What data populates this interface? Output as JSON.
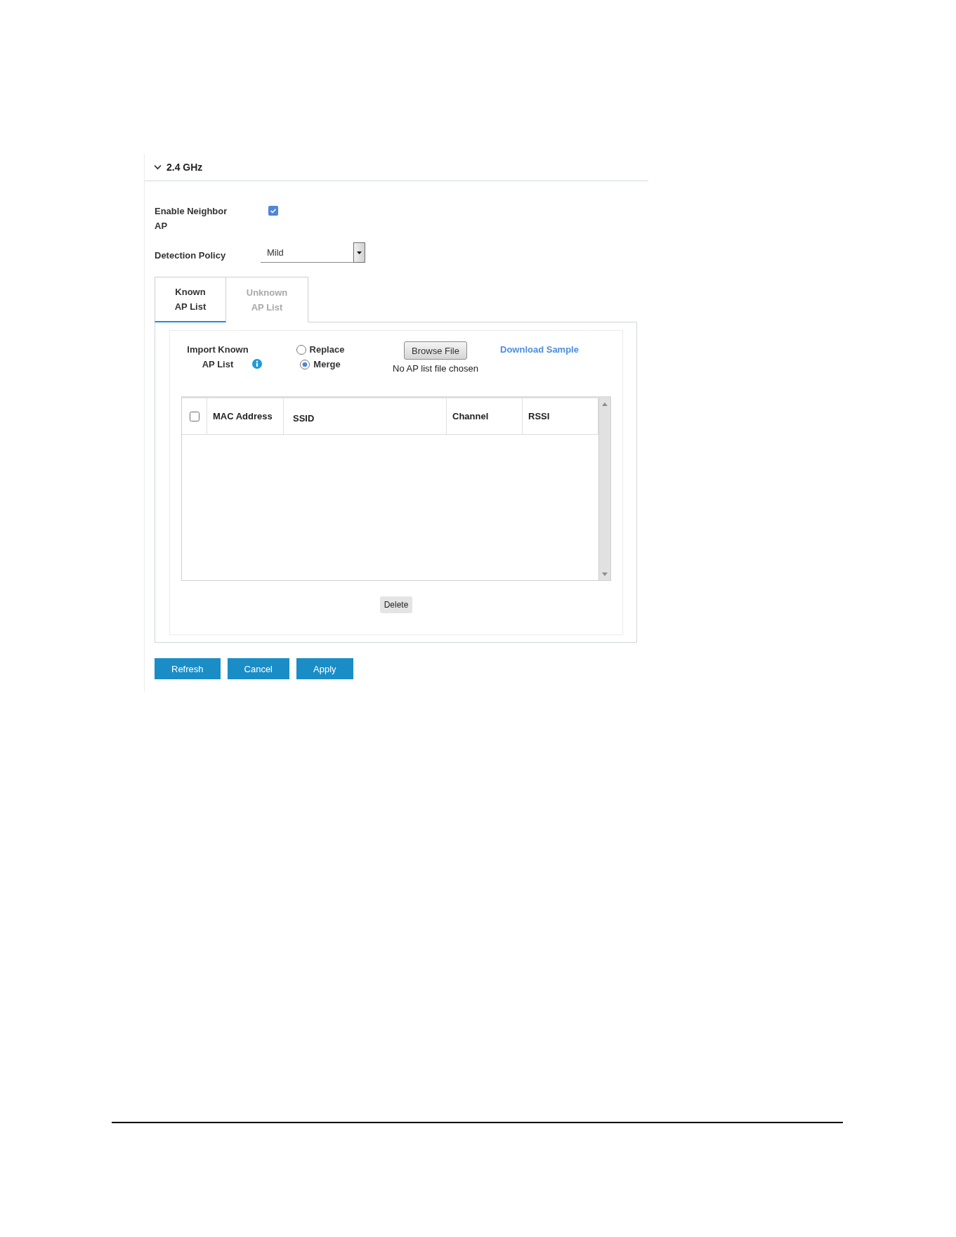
{
  "section": {
    "title": "2.4 GHz",
    "expanded": true
  },
  "fields": [
    {
      "kind": "checkbox",
      "label": "Enable Neighbor AP",
      "checked": true
    },
    {
      "kind": "select",
      "label": "Detection Policy",
      "value": "Mild"
    }
  ],
  "tabs": [
    {
      "label": "Known AP List",
      "selected": true
    },
    {
      "label": "Unknown AP List",
      "selected": false
    }
  ],
  "import": {
    "label": "Import Known AP List",
    "options": [
      {
        "label": "Replace",
        "selected": false
      },
      {
        "label": "Merge",
        "selected": true
      }
    ],
    "browse_button": "Browse File",
    "file_status": "No AP list file chosen",
    "download_link": "Download Sample"
  },
  "table": {
    "select_all": {
      "checked": false
    },
    "columns": [
      "MAC Address",
      "SSID",
      "Channel",
      "RSSI"
    ]
  },
  "delete_button": "Delete",
  "buttons": [
    "Refresh",
    "Cancel",
    "Apply"
  ]
}
